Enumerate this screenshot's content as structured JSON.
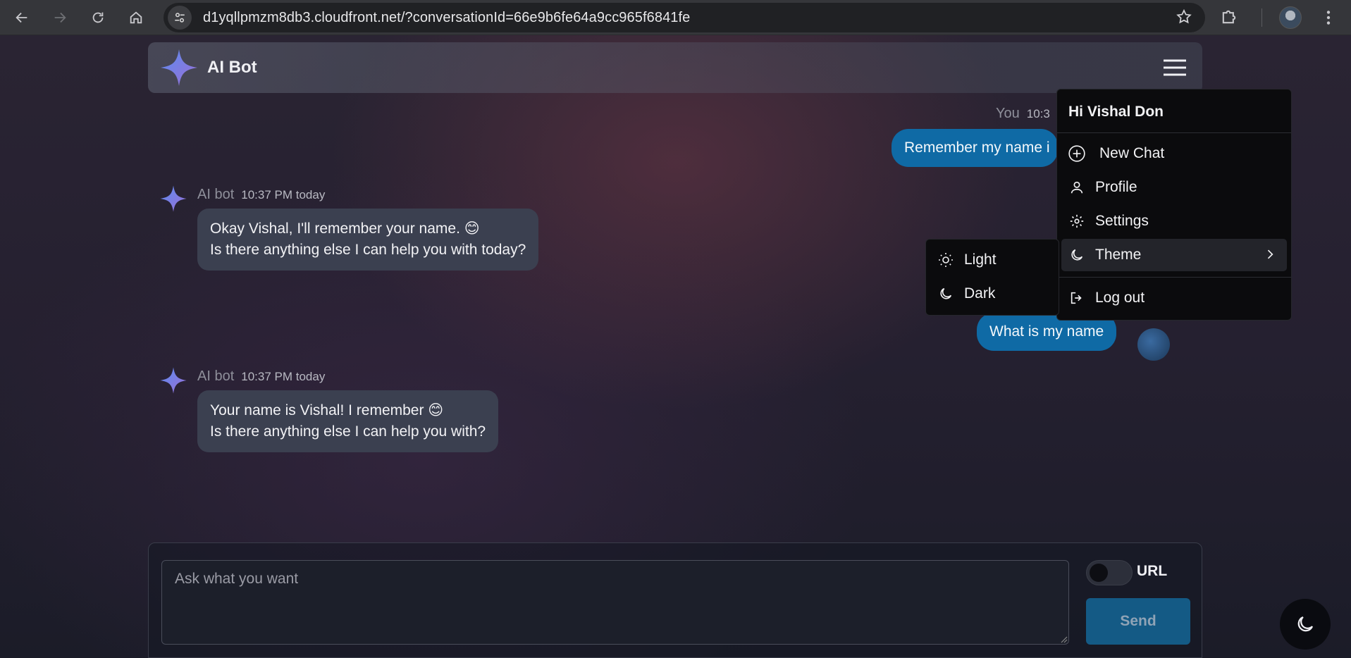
{
  "browser": {
    "url_host": "d1yqllpmzm8db3.cloudfront.net",
    "url_path": "/?conversationId=66e9b6fe64a9cc965f6841fe"
  },
  "header": {
    "title": "AI Bot"
  },
  "messages": [
    {
      "role": "user",
      "who": "You",
      "time": "10:3",
      "text": "Remember my name i"
    },
    {
      "role": "bot",
      "who": "AI bot",
      "time": "10:37 PM today",
      "lines": [
        "Okay Vishal, I'll remember your name. 😊",
        "Is there anything else I can help you with today?"
      ]
    },
    {
      "role": "user",
      "text": "What is my name"
    },
    {
      "role": "bot",
      "who": "AI bot",
      "time": "10:37 PM today",
      "lines": [
        "Your name is Vishal! I remember 😊",
        "Is there anything else I can help you with?"
      ]
    }
  ],
  "composer": {
    "placeholder": "Ask what you want",
    "url_toggle_label": "URL",
    "send_label": "Send"
  },
  "menu": {
    "greeting": "Hi Vishal Don",
    "items": [
      {
        "label": "New Chat",
        "icon": "plus-circle-icon"
      },
      {
        "label": "Profile",
        "icon": "user-icon"
      },
      {
        "label": "Settings",
        "icon": "gear-icon"
      },
      {
        "label": "Theme",
        "icon": "moon-icon"
      },
      {
        "label": "Log out",
        "icon": "logout-icon"
      }
    ]
  },
  "theme_submenu": {
    "items": [
      {
        "label": "Light",
        "icon": "sun-icon"
      },
      {
        "label": "Dark",
        "icon": "moon-icon"
      }
    ]
  },
  "colors": {
    "user_bubble": "#0f6aa5",
    "bot_bubble": "#3b4050",
    "menu_bg": "#0b0b0d",
    "send_button": "#145a85"
  }
}
